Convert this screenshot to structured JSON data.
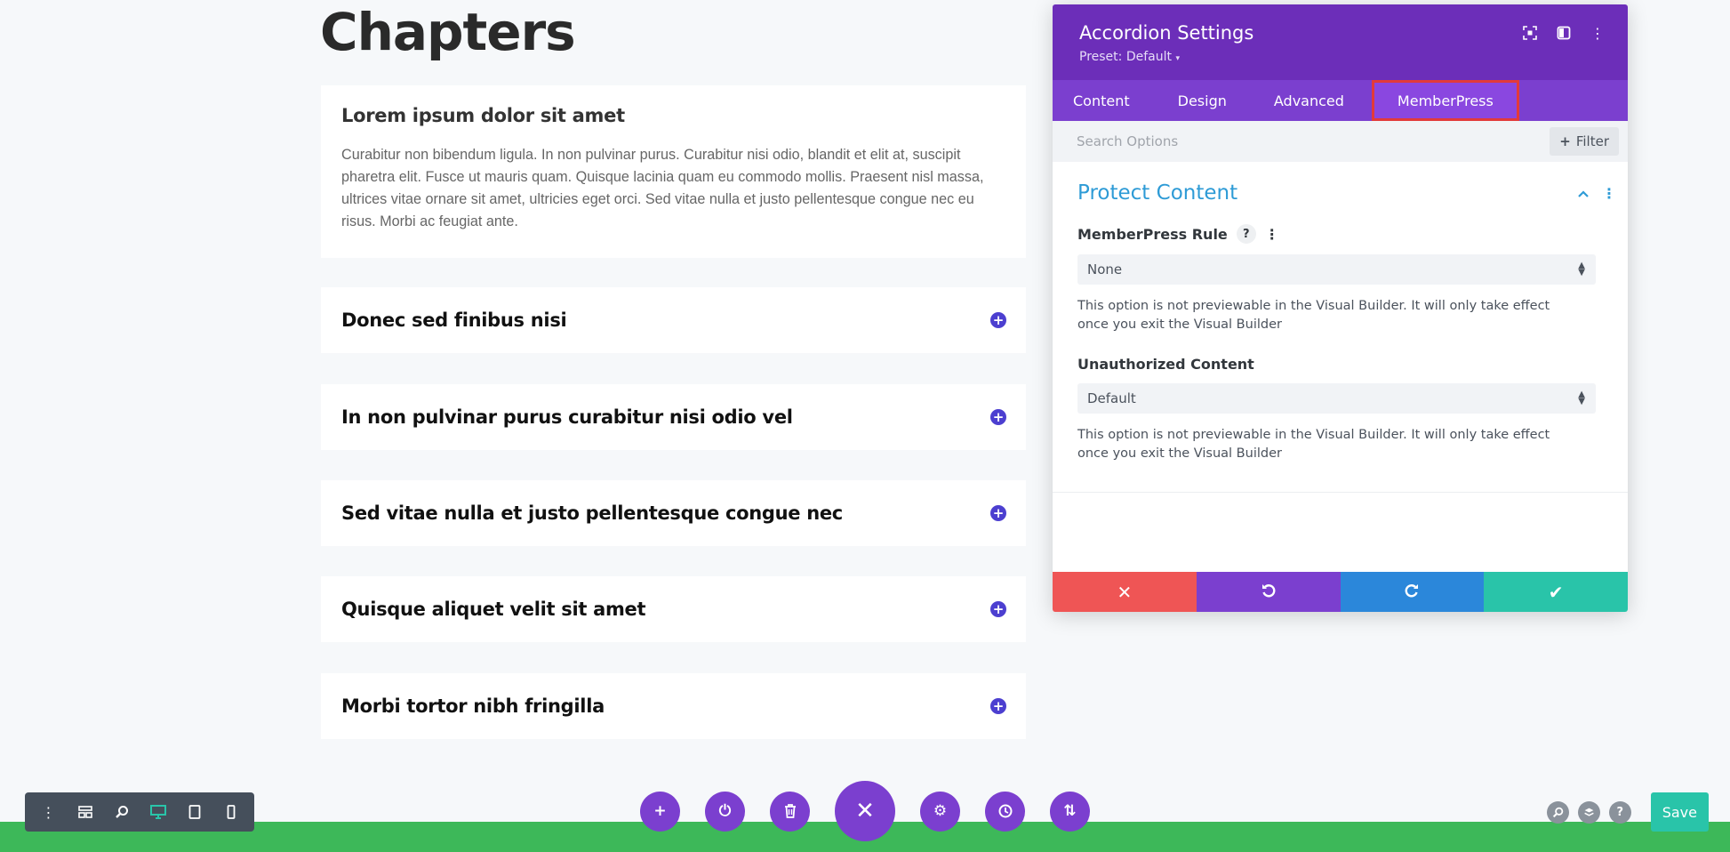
{
  "page": {
    "title": "Chapters",
    "accordion": [
      {
        "title": "Lorem ipsum dolor sit amet",
        "body": "Curabitur non bibendum ligula. In non pulvinar purus. Curabitur nisi odio, blandit et elit at, suscipit pharetra elit. Fusce ut mauris quam. Quisque lacinia quam eu commodo mollis. Praesent nisl massa, ultrices vitae ornare sit amet, ultricies eget orci. Sed vitae nulla et justo pellentesque congue nec eu risus. Morbi ac feugiat ante.",
        "open": true
      },
      {
        "title": "Donec sed finibus nisi",
        "open": false
      },
      {
        "title": "In non pulvinar purus curabitur nisi odio vel",
        "open": false
      },
      {
        "title": "Sed vitae nulla et justo pellentesque congue nec",
        "open": false
      },
      {
        "title": "Quisque aliquet velit sit amet",
        "open": false
      },
      {
        "title": "Morbi tortor nibh fringilla",
        "open": false
      }
    ]
  },
  "panel": {
    "title": "Accordion Settings",
    "preset": "Preset: Default",
    "tabs": [
      {
        "label": "Content"
      },
      {
        "label": "Design"
      },
      {
        "label": "Advanced"
      },
      {
        "label": "MemberPress",
        "active": true
      }
    ],
    "search": {
      "placeholder": "Search Options"
    },
    "filter_label": "Filter",
    "section": {
      "title": "Protect Content",
      "rule_label": "MemberPress Rule",
      "rule_value": "None",
      "rule_note": "This option is not previewable in the Visual Builder. It will only take effect once you exit the Visual Builder",
      "unauth_label": "Unauthorized Content",
      "unauth_value": "Default",
      "unauth_note": "This option is not previewable in the Visual Builder. It will only take effect once you exit the Visual Builder"
    }
  },
  "toolbar": {
    "save_label": "Save"
  },
  "colors": {
    "accent_purple": "#7b3fcf",
    "header_purple": "#6c2eb9",
    "teal": "#29c4a9",
    "blue": "#2b87da",
    "red": "#ef5555",
    "green_strip": "#3db859",
    "section_title": "#2e9bd6"
  }
}
